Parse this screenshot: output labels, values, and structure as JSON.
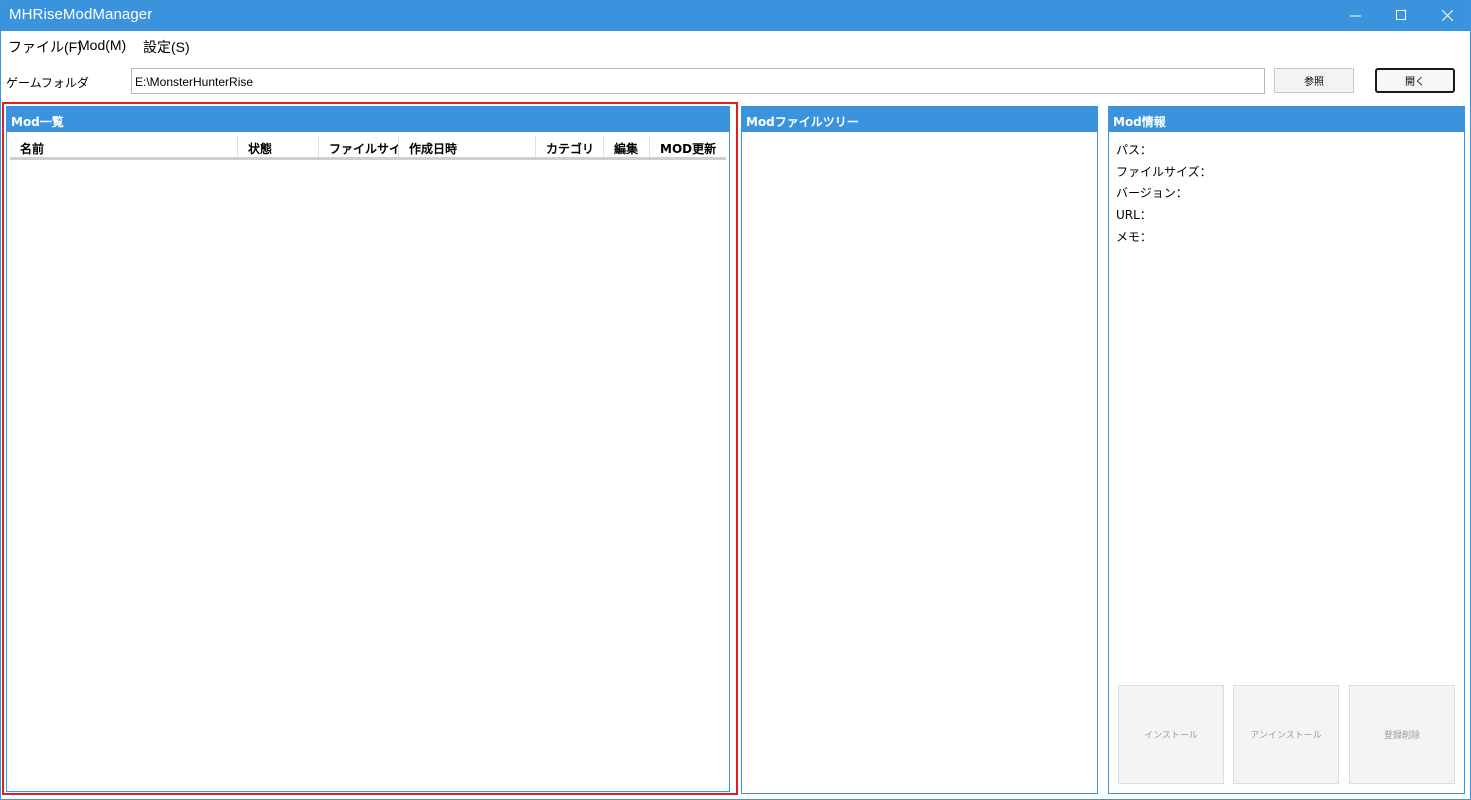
{
  "window": {
    "title": "MHRiseModManager",
    "controls": {
      "minimize": "minimize-icon",
      "maximize": "maximize-icon",
      "close": "close-icon"
    }
  },
  "menu": {
    "items": [
      {
        "label": "ファイル(F)"
      },
      {
        "label": "Mod(M)"
      },
      {
        "label": "設定(S)"
      }
    ]
  },
  "folder": {
    "label": "ゲームフォルダ",
    "value": "E:\\MonsterHunterRise",
    "browse_label": "参照",
    "open_label": "開く"
  },
  "mod_list": {
    "title": "Mod一覧",
    "columns": [
      "名前",
      "状態",
      "ファイルサイズ",
      "作成日時",
      "カテゴリ",
      "編集",
      "MOD更新"
    ],
    "rows": []
  },
  "file_tree": {
    "title": "Modファイルツリー"
  },
  "mod_info": {
    "title": "Mod情報",
    "fields": {
      "path": "パス：",
      "file_size": "ファイルサイズ：",
      "version": "バージョン：",
      "url": "URL：",
      "memo": "メモ："
    },
    "buttons": {
      "install": "インストール",
      "uninstall": "アンインストール",
      "unregister": "登録削除"
    }
  },
  "colors": {
    "accent": "#3b93de",
    "selection": "#e02020"
  }
}
